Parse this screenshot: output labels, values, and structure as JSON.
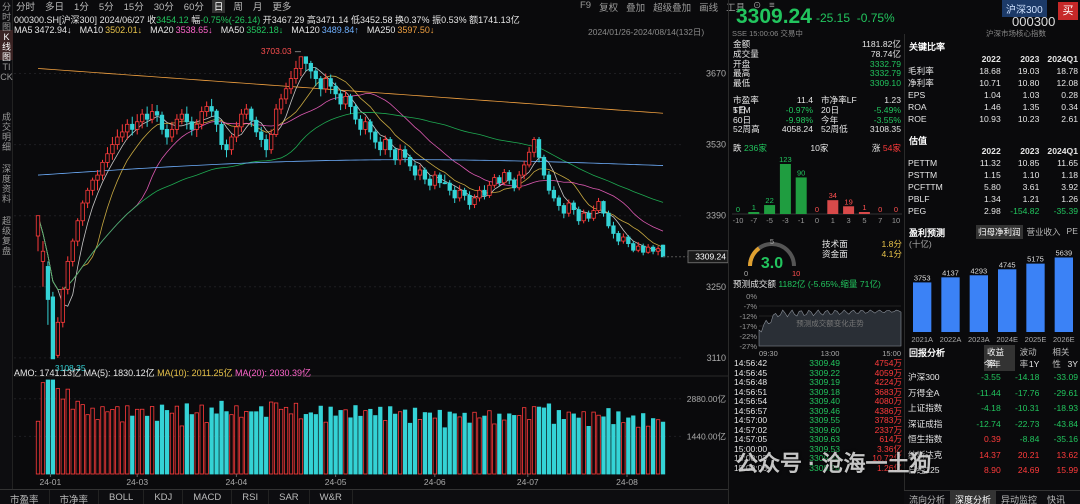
{
  "left_tabs": [
    "分时图",
    "K线图",
    "TICK",
    "成交明细",
    "深度资料",
    "超级复盘"
  ],
  "top_tabs": [
    "分时",
    "多日",
    "1分",
    "5分",
    "15分",
    "30分",
    "60分",
    "日",
    "周",
    "月",
    "更多"
  ],
  "top_tools": [
    "F9",
    "复权",
    "叠加",
    "超级叠加",
    "画线",
    "工具",
    "⊙",
    "≡"
  ],
  "info_line1": {
    "code": "000300.SH[沪深300]",
    "date": "2024/06/27",
    "close_lbl": "收",
    "close": "3454.12",
    "chg_lbl": "幅",
    "chg": "-0.75%(-26.14)",
    "open_lbl": "开",
    "open": "3467.29",
    "high_lbl": "高",
    "high": "3471.14",
    "low_lbl": "低",
    "low": "3452.58",
    "turn_lbl": "换",
    "turn": "0.37%",
    "amp_lbl": "振",
    "amp": "0.53%",
    "amt_lbl": "额",
    "amt": "1741.13亿"
  },
  "ma_line": [
    {
      "label": "MA5",
      "value": "3472.94↓",
      "color": "#e6e6e6"
    },
    {
      "label": "MA10",
      "value": "3502.01↓",
      "color": "#e8c34a"
    },
    {
      "label": "MA20",
      "value": "3538.65↓",
      "color": "#ff66cc"
    },
    {
      "label": "MA50",
      "value": "3582.18↓",
      "color": "#22c55e"
    },
    {
      "label": "MA120",
      "value": "3489.84↑",
      "color": "#6fb0ff"
    },
    {
      "label": "MA250",
      "value": "3597.50↓",
      "color": "#f0a040"
    }
  ],
  "range": "2024/01/26-2024/08/14(132日)",
  "price_ticks": [
    "3670",
    "3530",
    "3390",
    "3250",
    "3110"
  ],
  "last_price_tag": "3309.24",
  "annot_high": "3703.03",
  "annot_low": "3108.35",
  "vol_ticks": [
    "2880.00亿",
    "1440.00亿"
  ],
  "vol_info": {
    "amo": "AMO: 1741.13亿",
    "ma5": "MA(5): 1830.12亿",
    "ma10": "MA(10): 2011.25亿",
    "ma20": "MA(20): 2030.39亿"
  },
  "x_labels": [
    "24-01",
    "24-03",
    "24-04",
    "24-05",
    "24-06",
    "24-07",
    "24-08"
  ],
  "bottom_tabs": [
    "市盈率",
    "市净率",
    "BOLL",
    "KDJ",
    "MACD",
    "RSI",
    "SAR",
    "W&R"
  ],
  "quote": {
    "price": "3309.24",
    "chg": "-25.15",
    "pct": "-0.75%",
    "name": "沪深300",
    "code": "000300",
    "buy": "买",
    "meta": "SSE 15:00:06 交易中",
    "meta2": "沪深市场核心指数"
  },
  "stats": [
    [
      "金额",
      "1181.82亿"
    ],
    [
      "成交量",
      "78.74亿"
    ],
    [
      "开盘",
      "3332.79"
    ],
    [
      "最高",
      "3332.79"
    ],
    [
      "最低",
      "3309.10"
    ]
  ],
  "dual": [
    [
      "市盈率TTM",
      "11.4",
      "市净率LF",
      "1.23"
    ],
    [
      "5日",
      "-0.97%",
      "20日",
      "-5.49%"
    ],
    [
      "60日",
      "-9.98%",
      "今年",
      "-3.55%"
    ],
    [
      "52周高",
      "4058.24",
      "52周低",
      "3108.35"
    ]
  ],
  "updown": {
    "down_lbl": "跌",
    "down": "236家",
    "flat_lbl": "10家",
    "up_lbl": "涨",
    "up": "54家"
  },
  "dist": {
    "labels": [
      "-10",
      "-7",
      "-5",
      "-3",
      "-1",
      "0",
      "1",
      "3",
      "5",
      "7",
      "10"
    ],
    "values": [
      0,
      1,
      22,
      123,
      90,
      0,
      34,
      19,
      1,
      0,
      0
    ]
  },
  "gauge": {
    "score": "3.0",
    "lo": "0",
    "hi": "10",
    "mid": "5",
    "tech_lbl": "技术面",
    "tech": "1.8分",
    "fund_lbl": "资金面",
    "fund": "4.1分"
  },
  "forecast": {
    "label": "预测成交额",
    "value": "1182亿",
    "chg": "(-5.65%,缩量 71亿)",
    "yticks": [
      "-7%",
      "-12%",
      "-17%",
      "-22%",
      "-27%"
    ],
    "top": "0%",
    "overlay": "预测成交额变化走势",
    "times": [
      "09:30",
      "13:00",
      "15:00"
    ]
  },
  "ticks": [
    [
      "14:56:42",
      "3309.49",
      "4754万"
    ],
    [
      "14:56:45",
      "3309.22",
      "4059万"
    ],
    [
      "14:56:48",
      "3309.19",
      "4224万"
    ],
    [
      "14:56:51",
      "3309.18",
      "3683万"
    ],
    [
      "14:56:54",
      "3309.40",
      "4080万"
    ],
    [
      "14:56:57",
      "3309.46",
      "4386万"
    ],
    [
      "14:57:00",
      "3309.55",
      "3783万"
    ],
    [
      "14:57:02",
      "3309.60",
      "2337万"
    ],
    [
      "14:57:05",
      "3309.63",
      "614万"
    ],
    [
      "15:00:00",
      "3309.53",
      "3.36亿"
    ],
    [
      "15:00:03",
      "3309.24",
      "10.72亿"
    ],
    [
      "15:00:06",
      "3309.24",
      "1.26亿"
    ]
  ],
  "fin1": {
    "title": "关键比率",
    "head": [
      "",
      "2022",
      "2023",
      "2024Q1"
    ],
    "rows": [
      [
        "毛利率",
        "18.68",
        "19.03",
        "18.78"
      ],
      [
        "净利率",
        "10.71",
        "10.80",
        "12.08"
      ],
      [
        "EPS",
        "1.04",
        "1.03",
        "0.28"
      ],
      [
        "ROA",
        "1.46",
        "1.35",
        "0.34"
      ],
      [
        "ROE",
        "10.93",
        "10.23",
        "2.61"
      ]
    ]
  },
  "fin2": {
    "title": "估值",
    "head": [
      "",
      "2022",
      "2023",
      "2024Q1"
    ],
    "rows": [
      [
        "PETTM",
        "11.32",
        "10.85",
        "11.65"
      ],
      [
        "PSTTM",
        "1.15",
        "1.10",
        "1.18"
      ],
      [
        "PCFTTM",
        "5.80",
        "3.61",
        "3.92"
      ],
      [
        "PBLF",
        "1.34",
        "1.21",
        "1.26"
      ],
      [
        "PEG",
        "2.98",
        "-154.82",
        "-35.39"
      ]
    ]
  },
  "fc": {
    "title": "盈利预测",
    "tabs": [
      "归母净利润",
      "营业收入",
      "PE"
    ],
    "unit": "(十亿)",
    "years": [
      "2021A",
      "2022A",
      "2023A",
      "2024E",
      "2025E",
      "2026E"
    ],
    "values": [
      3753,
      4137,
      4293,
      4745,
      5175,
      5639
    ]
  },
  "hist": {
    "title": "回报分析",
    "tabs": [
      "收益率",
      "波动率",
      "相关性"
    ],
    "head": [
      "",
      "今年",
      "1Y",
      "3Y"
    ],
    "rows": [
      [
        "沪深300",
        "-3.55",
        "-14.18",
        "-33.09"
      ],
      [
        "万得全A",
        "-11.44",
        "-17.76",
        "-29.61"
      ],
      [
        "上证指数",
        "-4.18",
        "-10.31",
        "-18.93"
      ],
      [
        "深证成指",
        "-12.74",
        "-22.73",
        "-43.84"
      ],
      [
        "恒生指数",
        "0.39",
        "-8.84",
        "-35.16"
      ],
      [
        "纳斯达克",
        "14.37",
        "20.21",
        "13.62"
      ],
      [
        "日经225",
        "8.90",
        "24.69",
        "15.99"
      ]
    ]
  },
  "right_bottom_tabs": [
    "流向分析",
    "深度分析",
    "异动监控",
    "快讯"
  ],
  "watermark": "公众号 · 沧海一土狗",
  "colors": {
    "up": "#ff3b3b",
    "down": "#34d3d6",
    "green": "#22c55e",
    "accent": "#c62828"
  },
  "chart_data": {
    "type": "candlestick",
    "title": "000300.SH[沪深300]",
    "ylim": [
      3090,
      3740
    ],
    "price_ticks": [
      3670,
      3530,
      3390,
      3250,
      3110
    ],
    "candles": [
      [
        3350,
        3390,
        3360,
        3320
      ],
      [
        3300,
        3320,
        3340,
        3250
      ],
      [
        3290,
        3225,
        3300,
        3175
      ],
      [
        3230,
        3108,
        3240,
        3108
      ],
      [
        3115,
        3180,
        3190,
        3110
      ],
      [
        3180,
        3245,
        3250,
        3170
      ],
      [
        3245,
        3300,
        3310,
        3235
      ],
      [
        3300,
        3340,
        3345,
        3290
      ],
      [
        3340,
        3380,
        3385,
        3330
      ],
      [
        3380,
        3415,
        3420,
        3370
      ],
      [
        3415,
        3440,
        3445,
        3405
      ],
      [
        3440,
        3460,
        3465,
        3430
      ],
      [
        3460,
        3470,
        3480,
        3440
      ],
      [
        3470,
        3495,
        3500,
        3460
      ],
      [
        3495,
        3512,
        3525,
        3485
      ],
      [
        3512,
        3530,
        3545,
        3500
      ],
      [
        3530,
        3545,
        3560,
        3520
      ],
      [
        3545,
        3555,
        3570,
        3535
      ],
      [
        3555,
        3570,
        3580,
        3540
      ],
      [
        3570,
        3560,
        3585,
        3548
      ],
      [
        3560,
        3575,
        3590,
        3550
      ],
      [
        3575,
        3590,
        3600,
        3562
      ],
      [
        3590,
        3580,
        3605,
        3565
      ],
      [
        3580,
        3595,
        3610,
        3572
      ],
      [
        3595,
        3588,
        3608,
        3575
      ],
      [
        3588,
        3560,
        3595,
        3550
      ],
      [
        3560,
        3545,
        3570,
        3530
      ],
      [
        3545,
        3560,
        3575,
        3535
      ],
      [
        3560,
        3580,
        3590,
        3550
      ],
      [
        3580,
        3590,
        3600,
        3570
      ],
      [
        3590,
        3575,
        3605,
        3560
      ],
      [
        3575,
        3560,
        3585,
        3548
      ],
      [
        3560,
        3570,
        3580,
        3545
      ],
      [
        3570,
        3595,
        3605,
        3560
      ],
      [
        3595,
        3605,
        3615,
        3585
      ],
      [
        3605,
        3596,
        3620,
        3585
      ],
      [
        3596,
        3570,
        3600,
        3555
      ],
      [
        3570,
        3530,
        3575,
        3520
      ],
      [
        3530,
        3520,
        3540,
        3505
      ],
      [
        3520,
        3545,
        3550,
        3510
      ],
      [
        3545,
        3565,
        3575,
        3535
      ],
      [
        3565,
        3590,
        3600,
        3555
      ],
      [
        3590,
        3600,
        3610,
        3580
      ],
      [
        3600,
        3578,
        3605,
        3565
      ],
      [
        3578,
        3555,
        3585,
        3545
      ],
      [
        3555,
        3540,
        3565,
        3525
      ],
      [
        3540,
        3520,
        3550,
        3505
      ],
      [
        3520,
        3550,
        3560,
        3512
      ],
      [
        3550,
        3600,
        3610,
        3545
      ],
      [
        3600,
        3620,
        3630,
        3590
      ],
      [
        3620,
        3640,
        3652,
        3610
      ],
      [
        3640,
        3660,
        3675,
        3630
      ],
      [
        3660,
        3680,
        3695,
        3650
      ],
      [
        3680,
        3703,
        3703,
        3665
      ],
      [
        3703,
        3690,
        3700,
        3675
      ],
      [
        3690,
        3675,
        3695,
        3660
      ],
      [
        3675,
        3660,
        3682,
        3645
      ],
      [
        3660,
        3640,
        3665,
        3625
      ],
      [
        3640,
        3660,
        3670,
        3632
      ],
      [
        3660,
        3645,
        3668,
        3630
      ],
      [
        3645,
        3630,
        3652,
        3618
      ],
      [
        3630,
        3610,
        3638,
        3598
      ],
      [
        3610,
        3625,
        3635,
        3600
      ],
      [
        3625,
        3605,
        3630,
        3590
      ],
      [
        3605,
        3580,
        3610,
        3570
      ],
      [
        3580,
        3560,
        3588,
        3548
      ],
      [
        3560,
        3575,
        3585,
        3550
      ],
      [
        3575,
        3555,
        3580,
        3540
      ],
      [
        3555,
        3535,
        3560,
        3522
      ],
      [
        3535,
        3520,
        3545,
        3508
      ],
      [
        3520,
        3540,
        3548,
        3510
      ],
      [
        3540,
        3520,
        3545,
        3505
      ],
      [
        3520,
        3500,
        3525,
        3490
      ],
      [
        3500,
        3520,
        3530,
        3490
      ],
      [
        3520,
        3505,
        3528,
        3495
      ],
      [
        3505,
        3488,
        3510,
        3478
      ],
      [
        3488,
        3470,
        3495,
        3460
      ],
      [
        3470,
        3480,
        3490,
        3460
      ],
      [
        3480,
        3462,
        3485,
        3452
      ],
      [
        3462,
        3450,
        3470,
        3440
      ],
      [
        3450,
        3470,
        3478,
        3442
      ],
      [
        3470,
        3455,
        3475,
        3445
      ],
      [
        3455,
        3454,
        3471,
        3452
      ],
      [
        3454,
        3440,
        3460,
        3430
      ],
      [
        3440,
        3425,
        3448,
        3415
      ],
      [
        3425,
        3440,
        3450,
        3418
      ],
      [
        3440,
        3430,
        3445,
        3420
      ],
      [
        3430,
        3412,
        3438,
        3402
      ],
      [
        3412,
        3425,
        3432,
        3405
      ],
      [
        3425,
        3440,
        3448,
        3418
      ],
      [
        3440,
        3430,
        3450,
        3422
      ],
      [
        3430,
        3450,
        3458,
        3425
      ],
      [
        3450,
        3465,
        3472,
        3445
      ],
      [
        3465,
        3455,
        3470,
        3448
      ],
      [
        3455,
        3475,
        3482,
        3450
      ],
      [
        3475,
        3460,
        3480,
        3452
      ],
      [
        3460,
        3445,
        3465,
        3438
      ],
      [
        3445,
        3470,
        3478,
        3440
      ],
      [
        3470,
        3490,
        3498,
        3462
      ],
      [
        3490,
        3515,
        3525,
        3485
      ],
      [
        3515,
        3540,
        3545,
        3505
      ],
      [
        3540,
        3505,
        3545,
        3495
      ],
      [
        3505,
        3470,
        3510,
        3462
      ],
      [
        3470,
        3440,
        3478,
        3432
      ],
      [
        3440,
        3425,
        3448,
        3418
      ],
      [
        3425,
        3410,
        3430,
        3400
      ],
      [
        3410,
        3395,
        3415,
        3385
      ],
      [
        3395,
        3415,
        3422,
        3388
      ],
      [
        3415,
        3402,
        3420,
        3392
      ],
      [
        3402,
        3380,
        3408,
        3372
      ],
      [
        3380,
        3395,
        3402,
        3375
      ],
      [
        3395,
        3385,
        3400,
        3378
      ],
      [
        3385,
        3400,
        3410,
        3380
      ],
      [
        3400,
        3418,
        3425,
        3395
      ],
      [
        3418,
        3395,
        3420,
        3388
      ],
      [
        3395,
        3370,
        3400,
        3365
      ],
      [
        3370,
        3355,
        3378,
        3345
      ],
      [
        3355,
        3340,
        3360,
        3332
      ],
      [
        3340,
        3348,
        3355,
        3335
      ],
      [
        3348,
        3335,
        3352,
        3328
      ],
      [
        3335,
        3322,
        3340,
        3318
      ],
      [
        3322,
        3330,
        3338,
        3318
      ],
      [
        3330,
        3318,
        3335,
        3312
      ],
      [
        3318,
        3328,
        3334,
        3315
      ],
      [
        3328,
        3320,
        3332,
        3314
      ],
      [
        3320,
        3325,
        3330,
        3312
      ],
      [
        3332,
        3309,
        3333,
        3309
      ]
    ],
    "vol_ylim": [
      0,
      3600
    ]
  }
}
